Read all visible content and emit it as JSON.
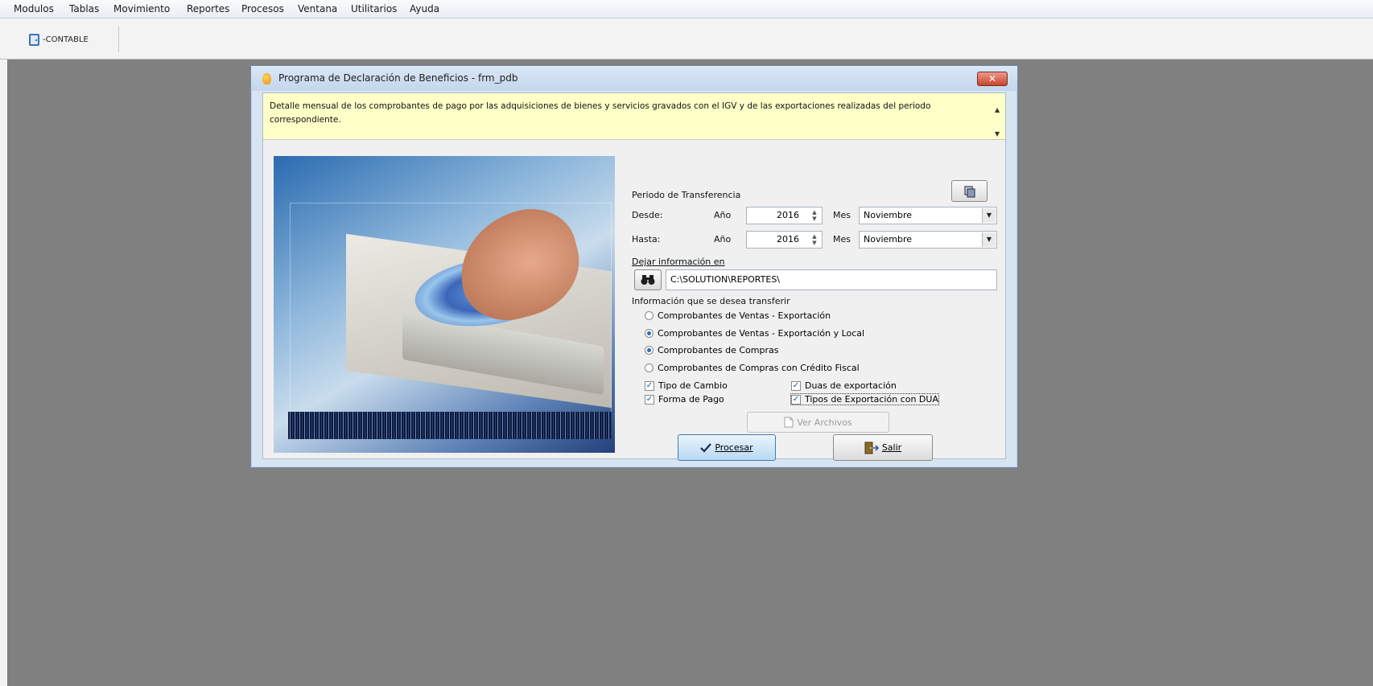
{
  "menubar": {
    "items": [
      "Modulos",
      "Tablas",
      "Movimiento",
      "Reportes",
      "Procesos",
      "Ventana",
      "Utilitarios",
      "Ayuda"
    ]
  },
  "toolbar": {
    "contable_label": "CONTABLE"
  },
  "dialog": {
    "title": "Programa de Declaración de Beneficios - frm_pdb",
    "close_label": "✕",
    "description": "Detalle mensual de los comprobantes de pago por las adquisiciones de bienes y servicios gravados con el IGV y de las exportaciones realizadas del periodo correspondiente.",
    "periodo_label": "Periodo de Transferencia",
    "desde": {
      "label": "Desde:",
      "anio_label": "Año",
      "anio_value": "2016",
      "mes_label": "Mes",
      "mes_value": "Noviembre"
    },
    "hasta": {
      "label": "Hasta:",
      "anio_label": "Año",
      "anio_value": "2016",
      "mes_label": "Mes",
      "mes_value": "Noviembre"
    },
    "dejar_label": "Dejar información en",
    "path_value": "C:\\SOLUTION\\REPORTES\\",
    "info_label": "Información que se desea transferir",
    "radios": [
      {
        "label": "Comprobantes de Ventas - Exportación",
        "checked": false
      },
      {
        "label": "Comprobantes de Ventas - Exportación y Local",
        "checked": true
      },
      {
        "label": "Comprobantes de Compras",
        "checked": true
      },
      {
        "label": "Comprobantes de Compras con Crédito Fiscal",
        "checked": false
      }
    ],
    "checks": [
      {
        "label": "Tipo de Cambio",
        "checked": true
      },
      {
        "label": "Forma de Pago",
        "checked": true
      },
      {
        "label": "Duas de exportación",
        "checked": true
      },
      {
        "label": "Tipos de Exportación con DUA",
        "checked": true
      }
    ],
    "ver_archivos_label": "Ver Archivos",
    "procesar_label": "Procesar",
    "salir_label": "Salir"
  },
  "colors": {
    "desktop": "#808080",
    "memo_bg": "#ffffc8",
    "title_bg": "#c3d6ec"
  },
  "icons": [
    "contable-door-icon",
    "app-flame-icon",
    "close-icon",
    "copy-icon",
    "binoculars-icon",
    "spin-arrows-icon",
    "dropdown-arrow-icon",
    "document-icon",
    "checkmark-icon",
    "exit-door-icon",
    "scroll-up-icon",
    "scroll-down-icon"
  ]
}
